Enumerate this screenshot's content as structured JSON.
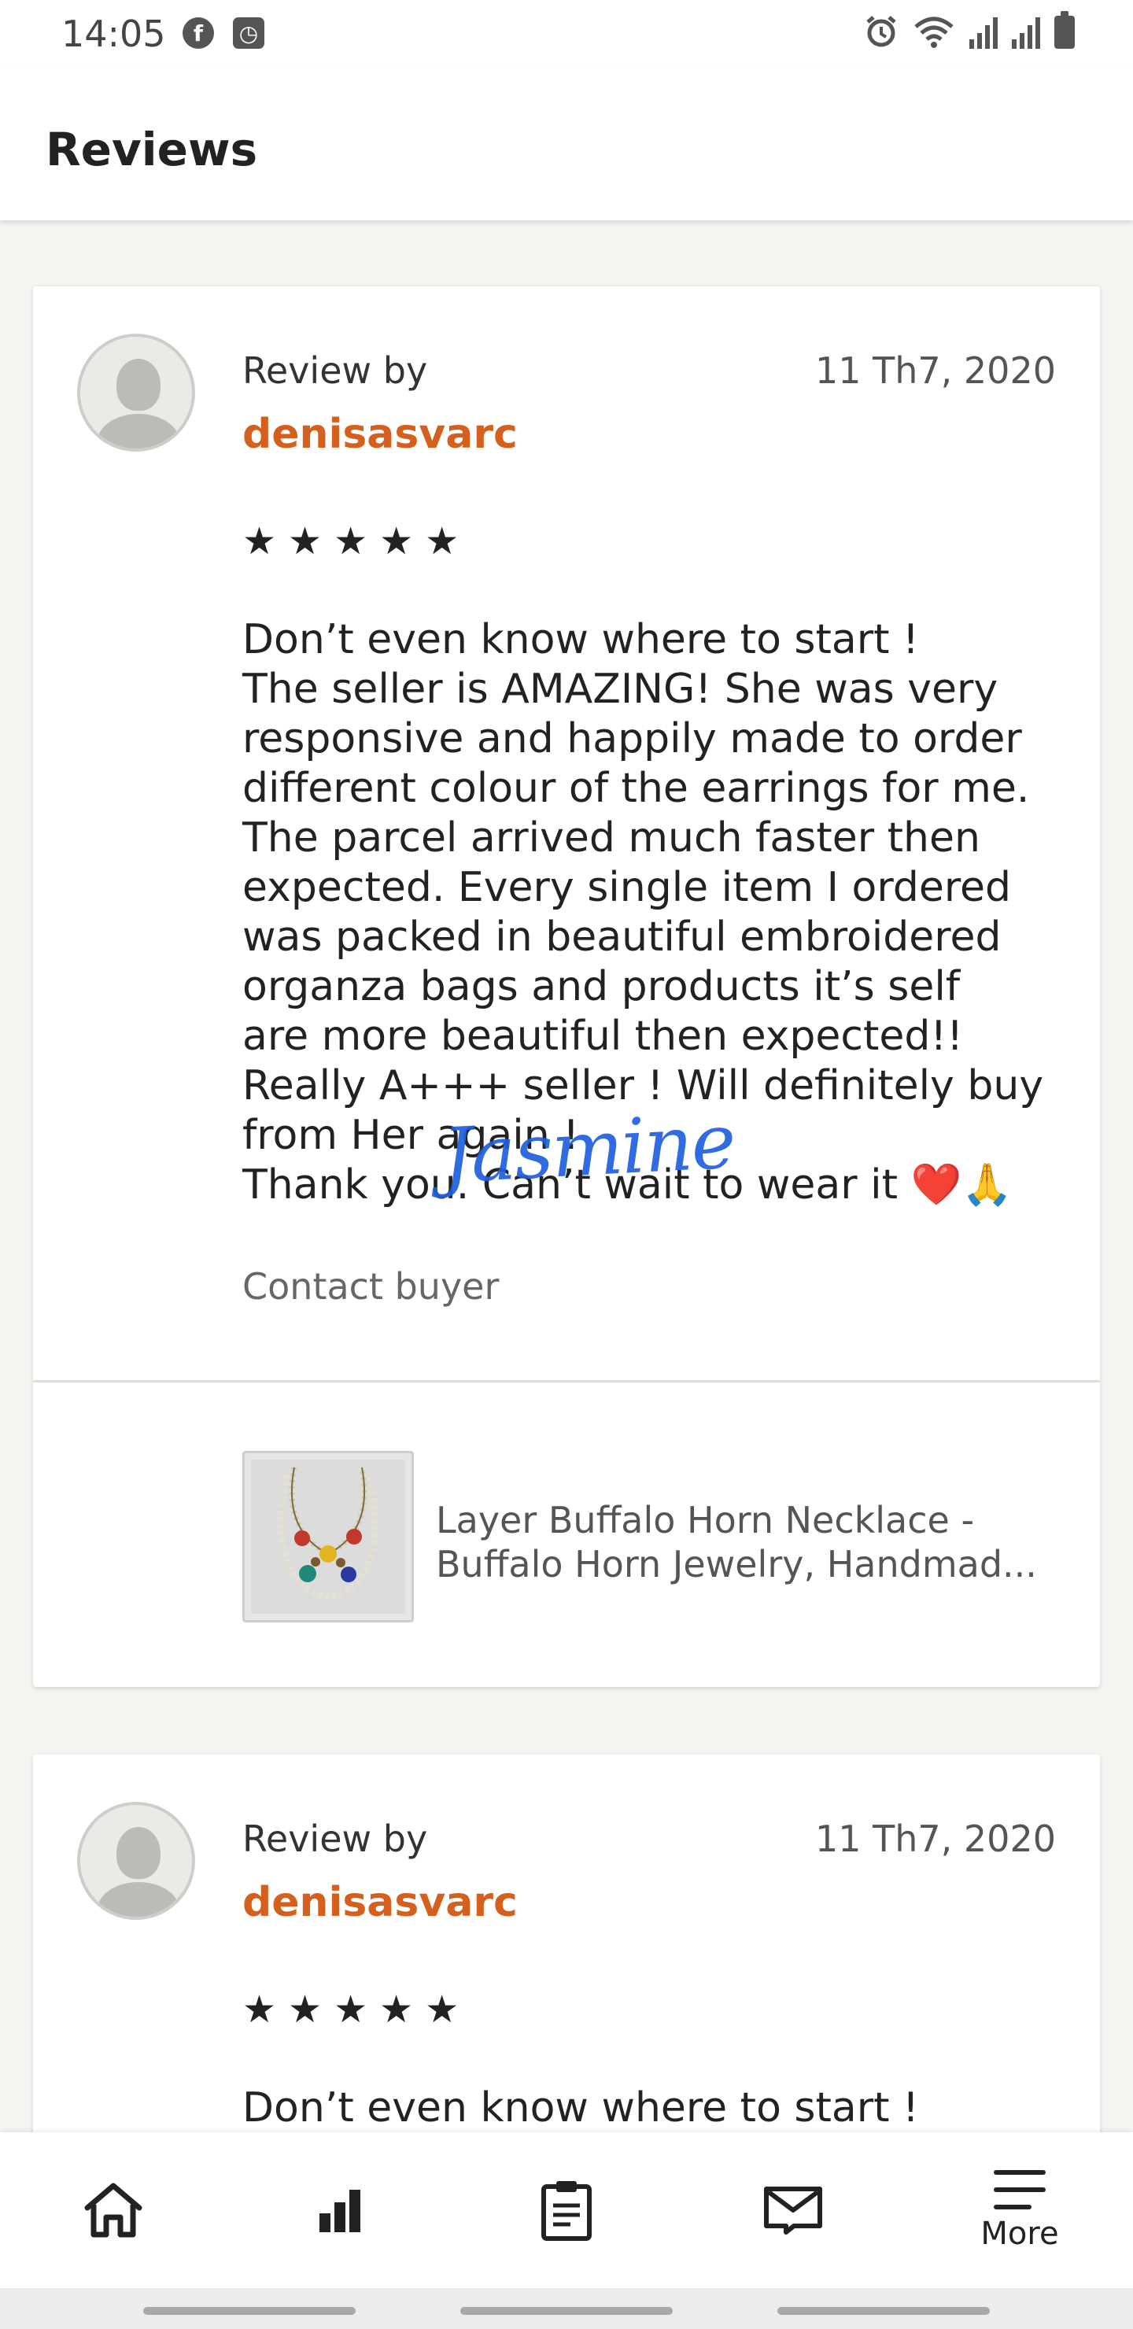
{
  "status_bar": {
    "time": "14:05",
    "left_icons": [
      "facebook-icon",
      "clock-app-icon"
    ],
    "right_icons": [
      "alarm-icon",
      "wifi-icon",
      "signal-icon",
      "signal-icon",
      "battery-icon"
    ]
  },
  "app_bar": {
    "title": "Reviews"
  },
  "reviews": [
    {
      "review_by_label": "Review by",
      "reviewer": "denisasvarc",
      "date": "11 Th7, 2020",
      "rating": 5,
      "text_lines": [
        "Don’t even know where to start !",
        "The seller is AMAZING! She was very",
        "responsive and happily made to order",
        "different colour of the earrings for me.",
        "The parcel arrived much faster then",
        "expected. Every single item I ordered",
        "was packed in beautiful embroidered",
        "organza bags and products it’s self",
        "are more beautiful then expected!!",
        "Really A+++ seller ! Will definitely buy",
        "from Her again !",
        "Thank you. Can’t wait to wear it ❤️🙏"
      ],
      "contact_label": "Contact buyer",
      "listing_title_line1": "Layer Buffalo Horn Necklace -",
      "listing_title_line2": "Buffalo Horn Jewelry, Handmad..."
    },
    {
      "review_by_label": "Review by",
      "reviewer": "denisasvarc",
      "date": "11 Th7, 2020",
      "rating": 5,
      "first_line": "Don’t even know where to start !"
    }
  ],
  "signature_overlay": "Jasmine",
  "bottom_nav": {
    "items": [
      {
        "icon": "home-icon",
        "label": ""
      },
      {
        "icon": "stats-icon",
        "label": ""
      },
      {
        "icon": "orders-clipboard-icon",
        "label": ""
      },
      {
        "icon": "messages-icon",
        "label": ""
      },
      {
        "icon": "menu-icon",
        "label": "More"
      }
    ]
  },
  "colors": {
    "accent_orange": "#d5601d",
    "background": "#f5f4f1",
    "card": "#ffffff",
    "signature_blue": "#1f5fe0"
  }
}
